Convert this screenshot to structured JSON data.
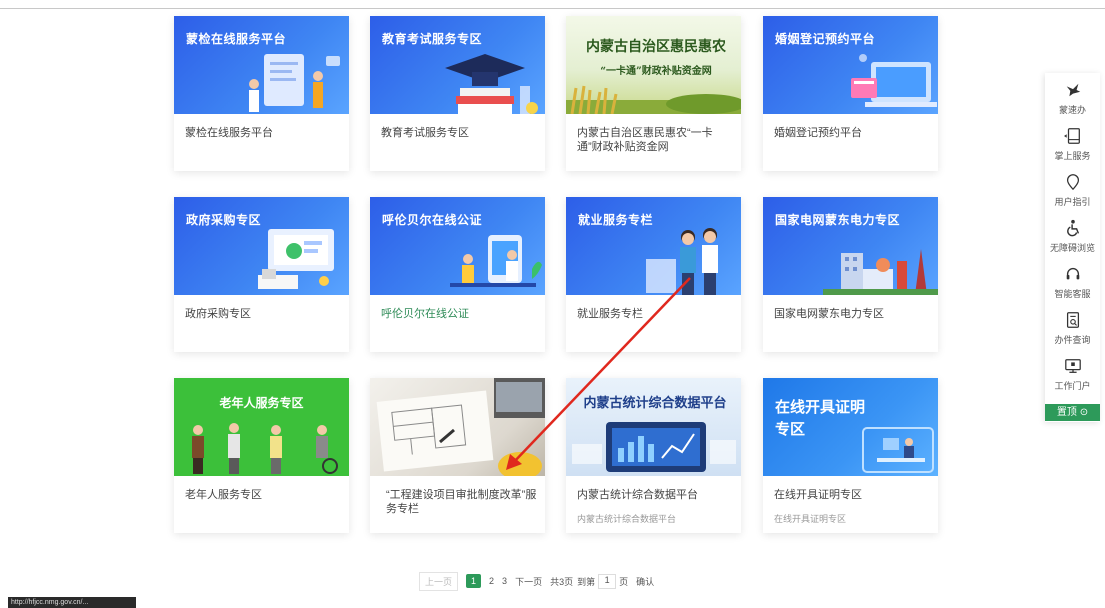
{
  "cards": [
    {
      "title": "蒙检在线服务平台",
      "label": "蒙检在线服务平台"
    },
    {
      "title": "教育考试服务专区",
      "label": "教育考试服务专区"
    },
    {
      "title_line1": "内蒙古自治区惠民惠农",
      "title_line2": "“一卡通”财政补贴资金网",
      "label": "内蒙古自治区惠民惠农“一卡通”财政补贴资金网"
    },
    {
      "title": "婚姻登记预约平台",
      "label": "婚姻登记预约平台"
    },
    {
      "title": "政府采购专区",
      "label": "政府采购专区"
    },
    {
      "title": "呼伦贝尔在线公证",
      "label": "呼伦贝尔在线公证"
    },
    {
      "title": "就业服务专栏",
      "label": "就业服务专栏"
    },
    {
      "title": "国家电网蒙东电力专区",
      "label": "国家电网蒙东电力专区"
    },
    {
      "title": "老年人服务专区",
      "label": "老年人服务专区"
    },
    {
      "title": "",
      "label": "“工程建设项目审批制度改革”服务专栏"
    },
    {
      "title": "内蒙古统计综合数据平台",
      "label": "内蒙古统计综合数据平台",
      "sub": "内蒙古统计综合数据平台"
    },
    {
      "title_line1": "在线开具证明",
      "title_line2": "专区",
      "label": "在线开具证明专区",
      "sub": "在线开具证明专区"
    }
  ],
  "sidebar": {
    "items": [
      {
        "label": "蒙速办",
        "icon": "bird-icon"
      },
      {
        "label": "掌上服务",
        "icon": "mobile-icon"
      },
      {
        "label": "用户指引",
        "icon": "location-icon"
      },
      {
        "label": "无障碍浏览",
        "icon": "accessibility-icon"
      },
      {
        "label": "智能客服",
        "icon": "headset-icon"
      },
      {
        "label": "办件查询",
        "icon": "document-search-icon"
      },
      {
        "label": "工作门户",
        "icon": "monitor-icon"
      }
    ],
    "top_label": "置顶"
  },
  "pagination": {
    "prev": "上一页",
    "pages": [
      "1",
      "2",
      "3"
    ],
    "current": "1",
    "next": "下一页",
    "total": "共3页",
    "goto": "到第",
    "goto_value": "1",
    "page_unit": "页",
    "confirm": "确认"
  },
  "status_url": "http://hfjcc.nmg.gov.cn/...",
  "colors": {
    "accent": "#2d9a5a",
    "blue": "#3f86f3",
    "green": "#3cc03a",
    "arrow": "#e0281e"
  }
}
